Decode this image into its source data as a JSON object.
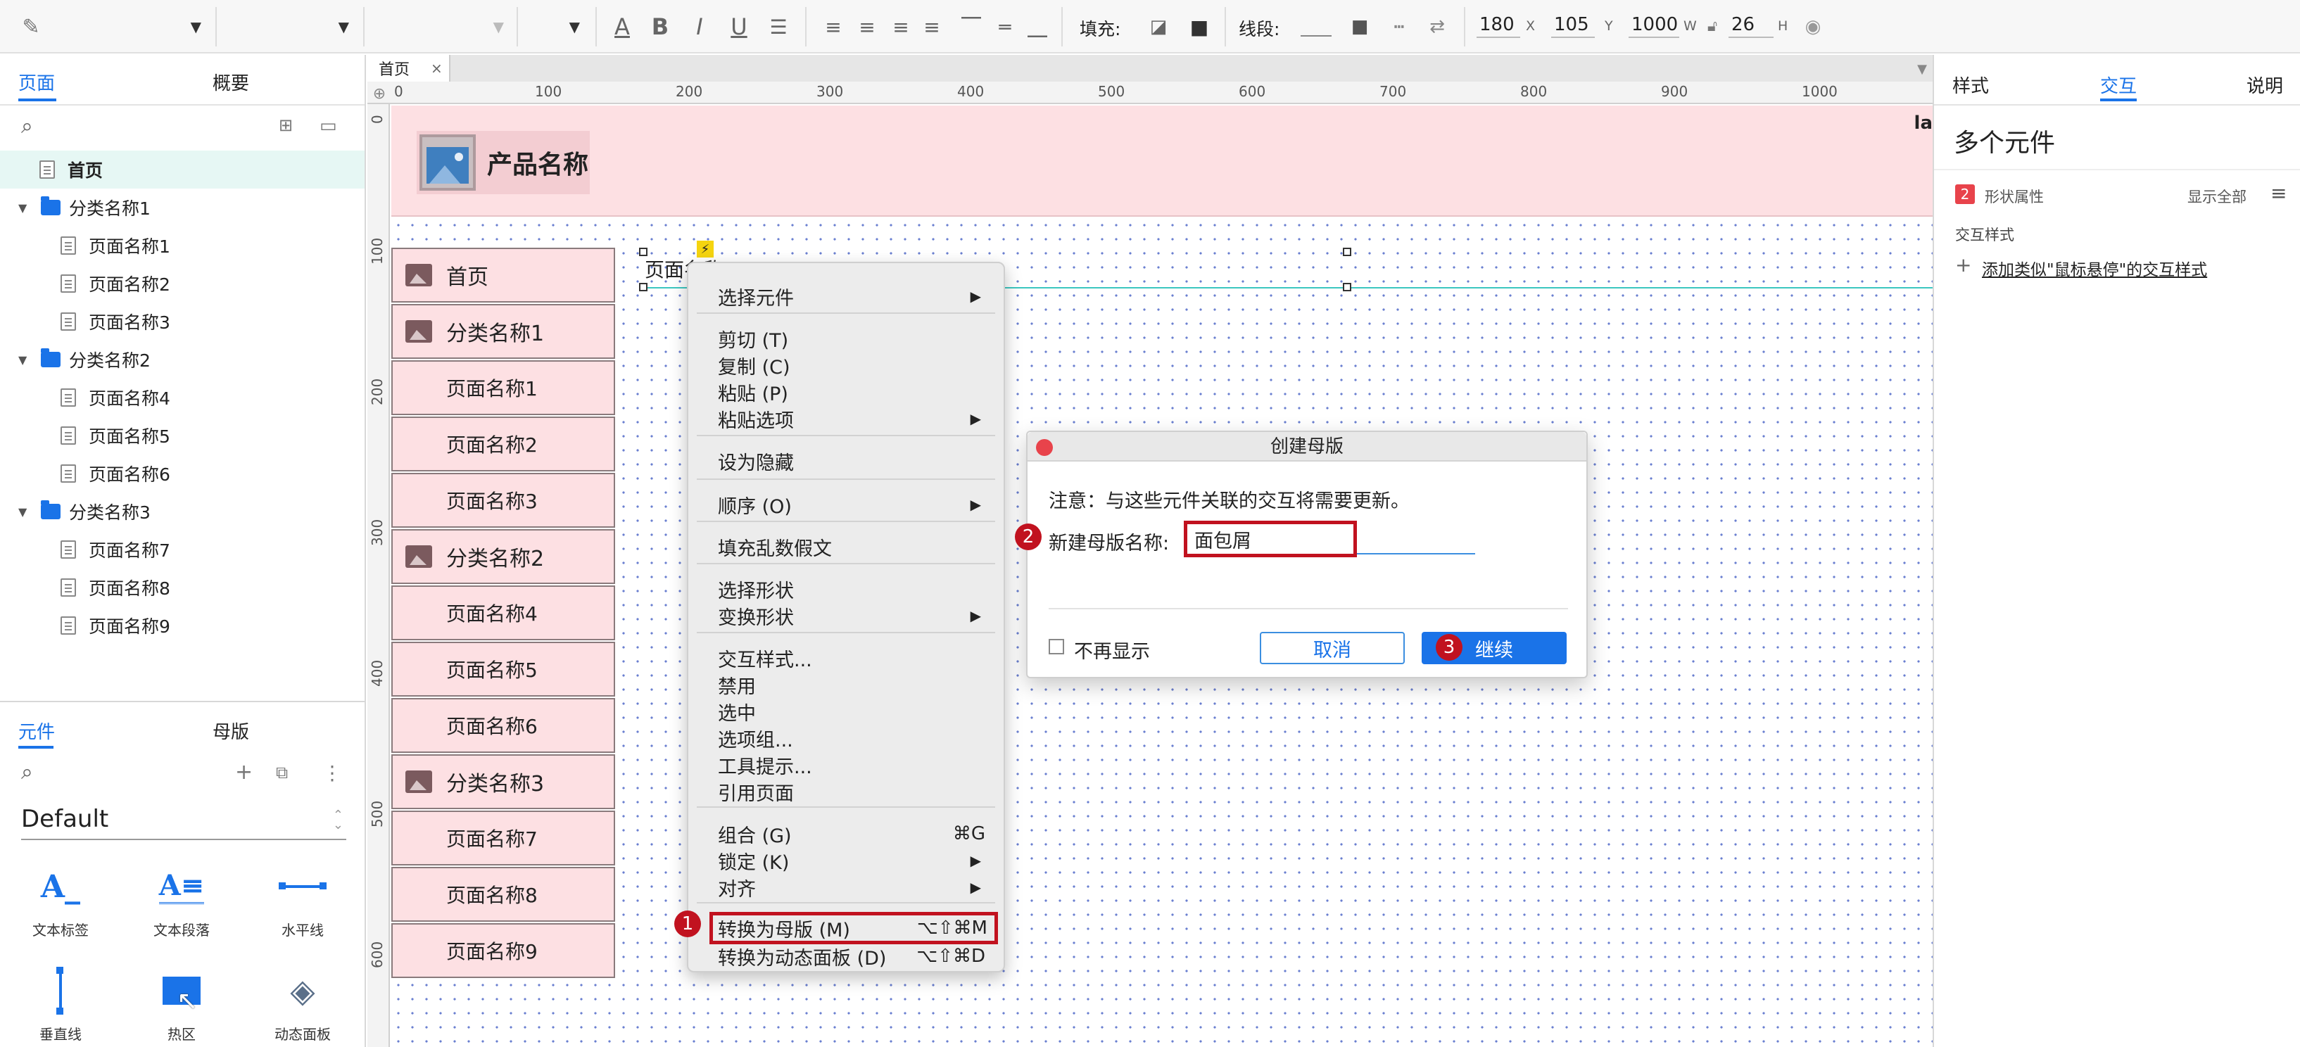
{
  "toolbar": {
    "fill_label": "填充:",
    "stroke_label": "线段:",
    "x": "180",
    "x_unit": "X",
    "y": "105",
    "y_unit": "Y",
    "w": "1000",
    "w_unit": "W",
    "h": "26",
    "h_unit": "H"
  },
  "left_panel": {
    "tab_pages": "页面",
    "tab_outline": "概要",
    "tree": [
      {
        "label": "首页",
        "level": 0,
        "type": "page",
        "selected": true
      },
      {
        "label": "分类名称1",
        "level": 0,
        "type": "folder"
      },
      {
        "label": "页面名称1",
        "level": 1,
        "type": "page"
      },
      {
        "label": "页面名称2",
        "level": 1,
        "type": "page"
      },
      {
        "label": "页面名称3",
        "level": 1,
        "type": "page"
      },
      {
        "label": "分类名称2",
        "level": 0,
        "type": "folder"
      },
      {
        "label": "页面名称4",
        "level": 1,
        "type": "page"
      },
      {
        "label": "页面名称5",
        "level": 1,
        "type": "page"
      },
      {
        "label": "页面名称6",
        "level": 1,
        "type": "page"
      },
      {
        "label": "分类名称3",
        "level": 0,
        "type": "folder"
      },
      {
        "label": "页面名称7",
        "level": 1,
        "type": "page"
      },
      {
        "label": "页面名称8",
        "level": 1,
        "type": "page"
      },
      {
        "label": "页面名称9",
        "level": 1,
        "type": "page"
      }
    ],
    "tab_widgets": "元件",
    "tab_masters": "母版",
    "library": "Default",
    "widgets": [
      {
        "label": "文本标签",
        "icon": "text-label-icon"
      },
      {
        "label": "文本段落",
        "icon": "text-paragraph-icon"
      },
      {
        "label": "水平线",
        "icon": "horizontal-line-icon"
      },
      {
        "label": "垂直线",
        "icon": "vertical-line-icon"
      },
      {
        "label": "热区",
        "icon": "hotspot-icon"
      },
      {
        "label": "动态面板",
        "icon": "dynamic-panel-icon"
      }
    ]
  },
  "canvas": {
    "tab": "首页",
    "ruler_h": [
      "0",
      "100",
      "200",
      "300",
      "400",
      "500",
      "600",
      "700",
      "800",
      "900",
      "1000"
    ],
    "ruler_v": [
      "0",
      "100",
      "200",
      "300",
      "400",
      "500",
      "600"
    ],
    "product_name": "产品名称",
    "edge_text": "la",
    "selected_text": "页面名称",
    "nav": [
      "首页",
      "分类名称1",
      "页面名称1",
      "页面名称2",
      "页面名称3",
      "分类名称2",
      "页面名称4",
      "页面名称5",
      "页面名称6",
      "分类名称3",
      "页面名称7",
      "页面名称8",
      "页面名称9"
    ]
  },
  "context_menu": {
    "items": [
      {
        "label": "选择元件",
        "arrow": true
      },
      {
        "label": "剪切 (T)"
      },
      {
        "label": "复制 (C)"
      },
      {
        "label": "粘贴 (P)"
      },
      {
        "label": "粘贴选项",
        "arrow": true
      },
      {
        "label": "设为隐藏"
      },
      {
        "label": "顺序 (O)",
        "arrow": true
      },
      {
        "label": "填充乱数假文"
      },
      {
        "label": "选择形状"
      },
      {
        "label": "变换形状",
        "arrow": true
      },
      {
        "label": "交互样式..."
      },
      {
        "label": "禁用"
      },
      {
        "label": "选中"
      },
      {
        "label": "选项组..."
      },
      {
        "label": "工具提示..."
      },
      {
        "label": "引用页面"
      },
      {
        "label": "组合 (G)",
        "shortcut": "⌘G"
      },
      {
        "label": "锁定 (K)",
        "arrow": true
      },
      {
        "label": "对齐",
        "arrow": true
      },
      {
        "label": "转换为母版 (M)",
        "shortcut": "⌥⇧⌘M",
        "highlight": true
      },
      {
        "label": "转换为动态面板 (D)",
        "shortcut": "⌥⇧⌘D"
      }
    ],
    "marker": "1"
  },
  "dialog": {
    "title": "创建母版",
    "notice": "注意：与这些元件关联的交互将需要更新。",
    "name_label": "新建母版名称:",
    "name_value": "面包屑",
    "dont_show": "不再显示",
    "cancel": "取消",
    "continue": "继续",
    "marker_name": "2",
    "marker_continue": "3"
  },
  "right_panel": {
    "tab_style": "样式",
    "tab_interaction": "交互",
    "tab_notes": "说明",
    "title": "多个元件",
    "badge": "2",
    "shape_props": "形状属性",
    "show_all": "显示全部",
    "interaction_style": "交互样式",
    "add_hover_link": "添加类似\"鼠标悬停\"的交互样式"
  },
  "colors": {
    "accent": "#1a73e8",
    "highlight": "#c1121f",
    "canvas_pink": "#fde0e3"
  }
}
